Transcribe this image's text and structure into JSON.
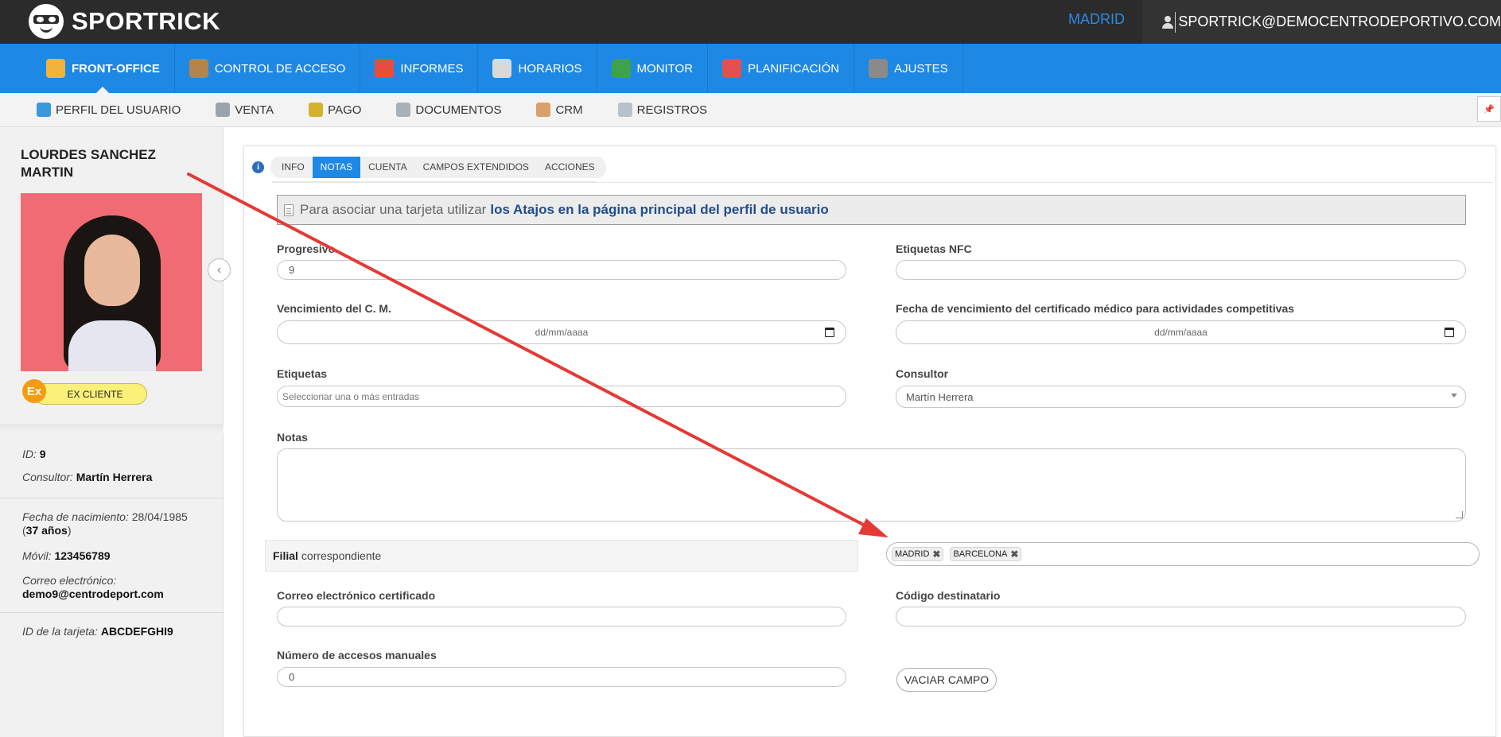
{
  "topbar": {
    "brand": "SPORTRICK",
    "city": "MADRID",
    "user_email": "SPORTRICK@DEMOCENTRODEPORTIVO.COM"
  },
  "main_nav": [
    {
      "label": "FRONT-OFFICE",
      "icon": "front-office-person-icon",
      "color": "#f2b33d"
    },
    {
      "label": "CONTROL DE ACCESO",
      "icon": "turnstile-icon",
      "color": "#b5844a"
    },
    {
      "label": "INFORMES",
      "icon": "pie-chart-icon",
      "color": "#e74c3c"
    },
    {
      "label": "HORARIOS",
      "icon": "schedule-grid-icon",
      "color": "#d9d9d9"
    },
    {
      "label": "MONITOR",
      "icon": "people-group-icon",
      "color": "#3da34a"
    },
    {
      "label": "PLANIFICACIÓN",
      "icon": "calendar-icon",
      "color": "#e25050"
    },
    {
      "label": "AJUSTES",
      "icon": "gear-icon",
      "color": "#8a8a8a"
    }
  ],
  "sub_nav": [
    {
      "label": "PERFIL DEL USUARIO",
      "icon": "user-profile-icon",
      "color": "#3a9ad9"
    },
    {
      "label": "VENTA",
      "icon": "cash-register-icon",
      "color": "#9aa3ab"
    },
    {
      "label": "PAGO",
      "icon": "coin-icon",
      "color": "#d4b22e"
    },
    {
      "label": "DOCUMENTOS",
      "icon": "document-icon",
      "color": "#a8b0b8"
    },
    {
      "label": "CRM",
      "icon": "handshake-icon",
      "color": "#d9a06a"
    },
    {
      "label": "REGISTROS",
      "icon": "notepad-icon",
      "color": "#b8c2cc"
    }
  ],
  "sidebar": {
    "name": "LOURDES SANCHEZ MARTIN",
    "badge_short": "Ex",
    "badge_label": "EX CLIENTE",
    "id_label": "ID:",
    "id_value": "9",
    "consultor_label": "Consultor:",
    "consultor_value": "Martín Herrera",
    "birth_label": "Fecha de nacimiento:",
    "birth_value": "28/04/1985",
    "age_value": "37 años",
    "mobile_label": "Móvil:",
    "mobile_value": "123456789",
    "email_label": "Correo electrónico:",
    "email_value": "demo9@centrodeport.com",
    "card_label": "ID de la tarjeta:",
    "card_value": "ABCDEFGHI9"
  },
  "tabs": [
    "INFO",
    "NOTAS",
    "CUENTA",
    "CAMPOS EXTENDIDOS",
    "ACCIONES"
  ],
  "active_tab": "NOTAS",
  "notice": {
    "text": "Para asociar una tarjeta utilizar",
    "strong": "los Atajos en la página principal del perfil de usuario"
  },
  "form": {
    "progresivo_label": "Progresivo",
    "progresivo_value": "9",
    "nfc_label": "Etiquetas NFC",
    "nfc_value": "",
    "cm_label": "Vencimiento del C. M.",
    "cm_placeholder": "dd/mm/aaaa",
    "cm_comp_label": "Fecha de vencimiento del certificado médico para actividades competitivas",
    "cm_comp_placeholder": "dd/mm/aaaa",
    "etiquetas_label": "Etiquetas",
    "etiquetas_placeholder": "Seleccionar una o más entradas",
    "consultor_label": "Consultor",
    "consultor_value": "Martín Herrera",
    "notas_label": "Notas",
    "filial_bold": "Filial",
    "filial_rest": "correspondiente",
    "filial_chips": [
      "MADRID",
      "BARCELONA"
    ],
    "pec_label": "Correo electrónico certificado",
    "codigo_label": "Código destinatario",
    "accesos_label": "Número de accesos manuales",
    "accesos_value": "0",
    "vaciar_label": "VACIAR CAMPO"
  },
  "colors": {
    "topbar": "#2b2b2b",
    "nav_blue": "#1e88e5",
    "annotation_arrow": "#e53935"
  }
}
